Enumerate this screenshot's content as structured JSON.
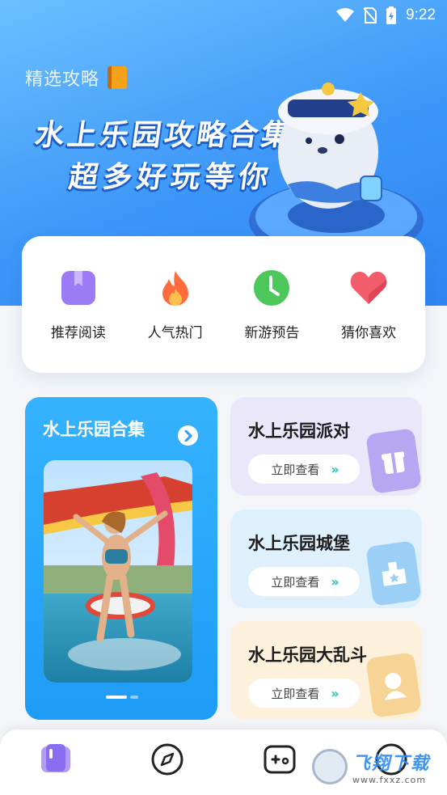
{
  "status_bar": {
    "time": "9:22"
  },
  "hero": {
    "tag": "精选攻略",
    "title": "水上乐园攻略合集",
    "subtitle": "超多好玩等你"
  },
  "quick_links": [
    {
      "label": "推荐阅读",
      "icon": "bookmark-icon",
      "color": "#9b7cf6"
    },
    {
      "label": "人气热门",
      "icon": "flame-icon",
      "color": "#ff6b3d"
    },
    {
      "label": "新游预告",
      "icon": "clock-icon",
      "color": "#4cc75a"
    },
    {
      "label": "猜你喜欢",
      "icon": "heart-icon",
      "color": "#f25c6b"
    }
  ],
  "feature": {
    "title": "水上乐园合集"
  },
  "side_cards": [
    {
      "title": "水上乐园派对",
      "button": "立即查看",
      "bg": "#ebe7fb",
      "deco_icon": "gift-icon"
    },
    {
      "title": "水上乐园城堡",
      "button": "立即查看",
      "bg": "#dff0fd",
      "deco_icon": "castle-icon"
    },
    {
      "title": "水上乐园大乱斗",
      "button": "立即查看",
      "bg": "#fdf1dc",
      "deco_icon": "avatar-icon"
    }
  ],
  "bottom_nav": [
    {
      "icon": "book-icon"
    },
    {
      "icon": "compass-icon"
    },
    {
      "icon": "gamepad-icon"
    },
    {
      "icon": "profile-icon"
    }
  ],
  "watermark": {
    "main": "飞翔下载",
    "sub": "www.fxxz.com"
  }
}
